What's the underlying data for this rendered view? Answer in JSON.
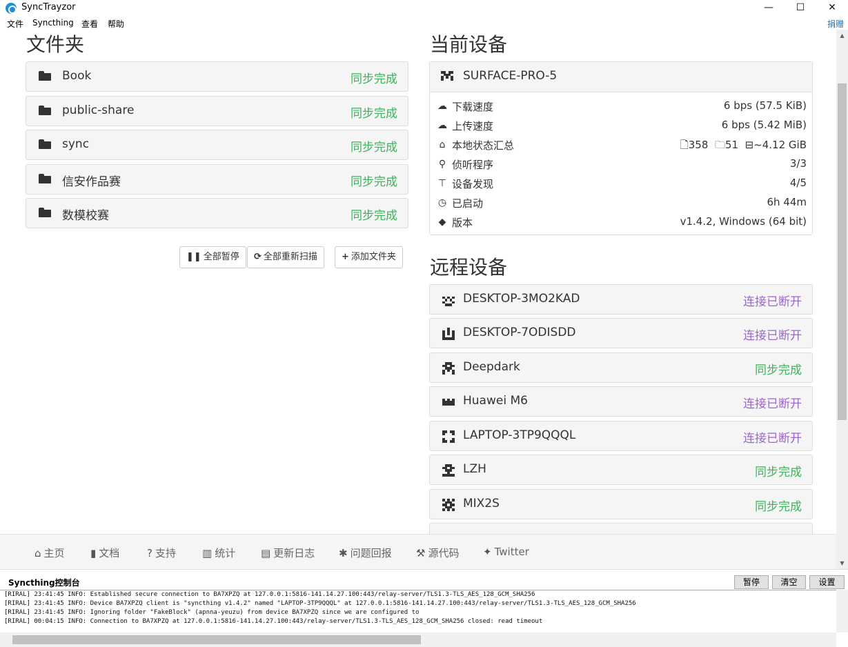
{
  "window": {
    "title": "SyncTrayzor",
    "minimize": "—",
    "maximize": "☐",
    "close": "✕"
  },
  "menu": {
    "items": [
      "文件",
      "Syncthing",
      "查看",
      "帮助"
    ],
    "donate": "捐赠"
  },
  "folders": {
    "heading": "文件夹",
    "items": [
      {
        "name": "Book",
        "status": "同步完成"
      },
      {
        "name": "public-share",
        "status": "同步完成"
      },
      {
        "name": "sync",
        "status": "同步完成"
      },
      {
        "name": "信安作品赛",
        "status": "同步完成"
      },
      {
        "name": "数模校赛",
        "status": "同步完成"
      }
    ],
    "pause_all": "全部暂停",
    "rescan_all": "全部重新扫描",
    "add_folder": "添加文件夹"
  },
  "this_device": {
    "heading": "当前设备",
    "name": "SURFACE-PRO-5",
    "rows": [
      {
        "icon": "cloud-download-icon",
        "label": "下载速度",
        "value": "6 bps (57.5 KiB)"
      },
      {
        "icon": "cloud-upload-icon",
        "label": "上传速度",
        "value": "6 bps (5.42 MiB)"
      },
      {
        "icon": "home-icon",
        "label": "本地状态汇总",
        "files": "358",
        "dirs": "51",
        "size": "~4.12 GiB"
      },
      {
        "icon": "sitemap-icon",
        "label": "侦听程序",
        "value": "3/3"
      },
      {
        "icon": "signpost-icon",
        "label": "设备发现",
        "value": "4/5"
      },
      {
        "icon": "clock-icon",
        "label": "已启动",
        "value": "6h 44m"
      },
      {
        "icon": "tag-icon",
        "label": "版本",
        "value": "v1.4.2, Windows (64 bit)"
      }
    ]
  },
  "remote_devices": {
    "heading": "远程设备",
    "items": [
      {
        "name": "DESKTOP-3MO2KAD",
        "status": "连接已断开"
      },
      {
        "name": "DESKTOP-7ODISDD",
        "status": "连接已断开"
      },
      {
        "name": "Deepdark",
        "status": "同步完成"
      },
      {
        "name": "Huawei M6",
        "status": "连接已断开"
      },
      {
        "name": "LAPTOP-3TP9QQQL",
        "status": "连接已断开"
      },
      {
        "name": "LZH",
        "status": "同步完成"
      },
      {
        "name": "MIX2S",
        "status": "同步完成"
      }
    ]
  },
  "footer": {
    "links": [
      {
        "icon": "home-icon",
        "label": "主页"
      },
      {
        "icon": "book-icon",
        "label": "文档"
      },
      {
        "icon": "question-circle-icon",
        "label": "支持"
      },
      {
        "icon": "bar-chart-icon",
        "label": "统计"
      },
      {
        "icon": "file-text-icon",
        "label": "更新日志"
      },
      {
        "icon": "bug-icon",
        "label": "问题回报"
      },
      {
        "icon": "wrench-icon",
        "label": "源代码"
      },
      {
        "icon": "twitter-icon",
        "label": "Twitter"
      }
    ]
  },
  "console": {
    "title": "Syncthing控制台",
    "pause": "暂停",
    "clear": "清空",
    "settings": "设置",
    "lines": [
      "[RIRAL] 23:41:45 INFO: Established secure connection to BA7XPZQ at 127.0.0.1:5816-141.14.27.100:443/relay-server/TLS1.3-TLS_AES_128_GCM_SHA256",
      "[RIRAL] 23:41:45 INFO: Device BA7XPZQ client is \"syncthing v1.4.2\" named \"LAPTOP-3TP9QQQL\" at 127.0.0.1:5816-141.14.27.100:443/relay-server/TLS1.3-TLS_AES_128_GCM_SHA256",
      "[RIRAL] 23:41:45 INFO: Ignoring folder \"FakeBlock\" (apnna-yeuzu) from device BA7XPZQ since we are configured to",
      "[RIRAL] 00:04:15 INFO: Connection to BA7XPZQ at 127.0.0.1:5816-141.14.27.100:443/relay-server/TLS1.3-TLS_AES_128_GCM_SHA256 closed: read timeout"
    ]
  },
  "colors": {
    "ok": "#3cb45a",
    "disconnected": "#9b67c8",
    "accent": "#1a73c9"
  }
}
